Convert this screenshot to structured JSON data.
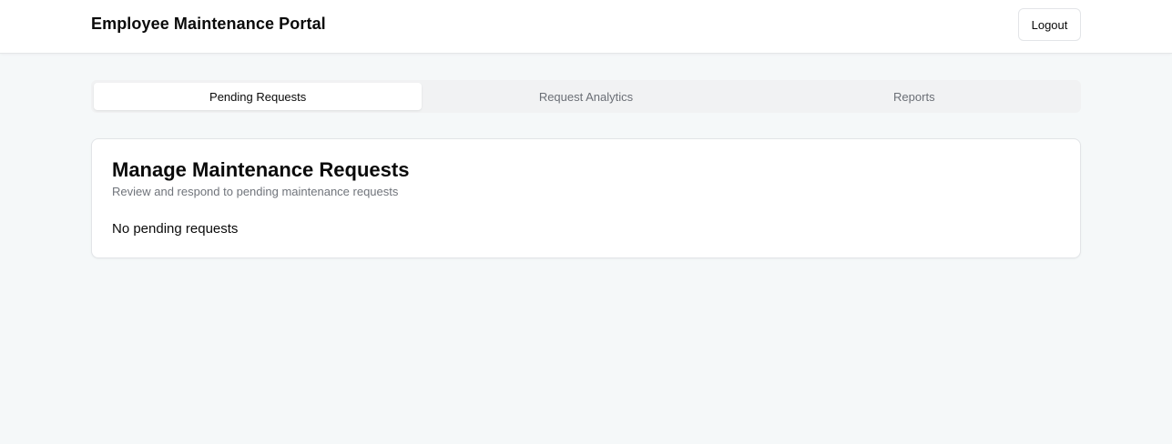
{
  "header": {
    "title": "Employee Maintenance Portal",
    "logout_label": "Logout"
  },
  "tabs": [
    {
      "label": "Pending Requests",
      "active": true
    },
    {
      "label": "Request Analytics",
      "active": false
    },
    {
      "label": "Reports",
      "active": false
    }
  ],
  "card": {
    "title": "Manage Maintenance Requests",
    "subtitle": "Review and respond to pending maintenance requests",
    "empty_message": "No pending requests"
  },
  "colors": {
    "page_background": "#f5f8f9",
    "surface": "#ffffff",
    "tab_track": "#f1f2f3",
    "muted_text": "#6b6f76"
  }
}
